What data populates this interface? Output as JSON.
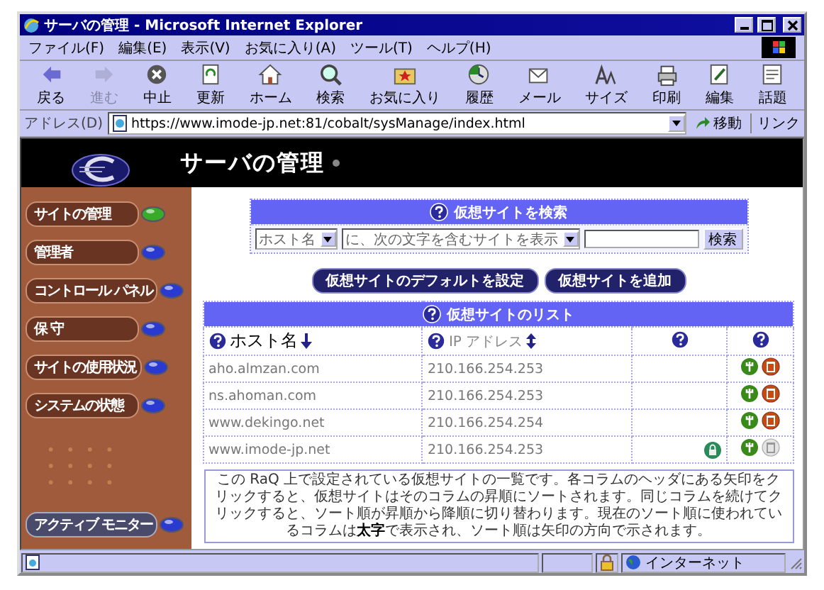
{
  "window": {
    "title": "サーバの管理 - Microsoft Internet Explorer"
  },
  "menu": [
    "ファイル(F)",
    "編集(E)",
    "表示(V)",
    "お気に入り(A)",
    "ツール(T)",
    "ヘルプ(H)"
  ],
  "toolbar": [
    {
      "label": "戻る",
      "disabled": false
    },
    {
      "label": "進む",
      "disabled": true
    },
    {
      "label": "中止",
      "disabled": false
    },
    {
      "label": "更新",
      "disabled": false
    },
    {
      "label": "ホーム",
      "disabled": false
    },
    {
      "label": "検索",
      "disabled": false
    },
    {
      "label": "お気に入り",
      "disabled": false
    },
    {
      "label": "履歴",
      "disabled": false
    },
    {
      "label": "メール",
      "disabled": false
    },
    {
      "label": "サイズ",
      "disabled": false
    },
    {
      "label": "印刷",
      "disabled": false
    },
    {
      "label": "編集",
      "disabled": false
    },
    {
      "label": "話題",
      "disabled": false
    }
  ],
  "address": {
    "label": "アドレス(D)",
    "url": "https://www.imode-jp.net:81/cobalt/sysManage/index.html",
    "go": "移動",
    "links": "リンク"
  },
  "page": {
    "title": "サーバの管理"
  },
  "sidebar": {
    "items": [
      {
        "label": "サイトの管理",
        "selected": true
      },
      {
        "label": "管理者",
        "selected": false
      },
      {
        "label": "コントロール パネル",
        "selected": false
      },
      {
        "label": "保 守",
        "selected": false
      },
      {
        "label": "サイトの使用状況",
        "selected": false
      },
      {
        "label": "システムの状態",
        "selected": false
      }
    ],
    "monitor": {
      "label": "アクティブ モニター"
    }
  },
  "search": {
    "title": "仮想サイトを検索",
    "field": "ホスト名",
    "condition": "に、次の文字を含むサイトを表示",
    "button": "検索"
  },
  "actions": [
    "仮想サイトのデフォルトを設定",
    "仮想サイトを追加"
  ],
  "table": {
    "title": "仮想サイトのリスト",
    "columns": [
      {
        "label": "ホスト名",
        "sorted": true
      },
      {
        "label": "IP アドレス",
        "sorted": false
      }
    ],
    "rows": [
      {
        "host": "aho.almzan.com",
        "ip": "210.166.254.253",
        "status_icon": false,
        "deletable": true
      },
      {
        "host": "ns.ahoman.com",
        "ip": "210.166.254.253",
        "status_icon": false,
        "deletable": true
      },
      {
        "host": "www.dekingo.net",
        "ip": "210.166.254.254",
        "status_icon": false,
        "deletable": true
      },
      {
        "host": "www.imode-jp.net",
        "ip": "210.166.254.253",
        "status_icon": true,
        "deletable": false
      }
    ]
  },
  "note": "この RaQ 上で設定されている仮想サイトの一覧です。各コラムのヘッダにある矢印をクリックすると、仮想サイトはそのコラムの昇順にソートされます。同じコラムを続けてクリックすると、ソート順が昇順から降順に切り替わります。現在のソート順に使われているコラムは**太字**で表示され、ソート順は矢印の方向で示されます。",
  "status_bar": {
    "zone": "インターネット"
  }
}
